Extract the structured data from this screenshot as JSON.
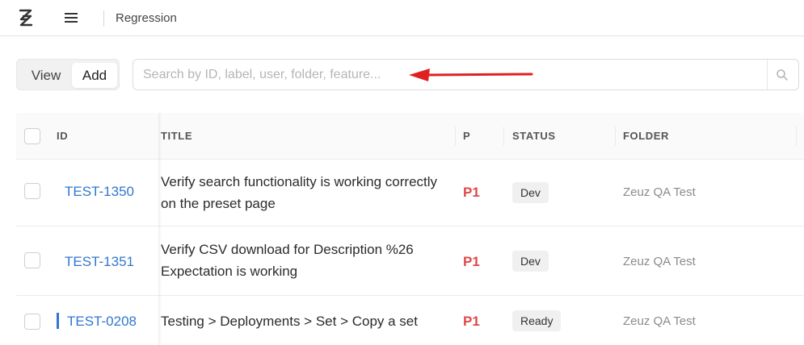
{
  "header": {
    "breadcrumb": "Regression"
  },
  "mode_toggle": {
    "view_label": "View",
    "add_label": "Add"
  },
  "search": {
    "placeholder": "Search by ID, label, user, folder, feature...",
    "value": ""
  },
  "table": {
    "columns": {
      "id": "ID",
      "title": "TITLE",
      "priority": "P",
      "status": "STATUS",
      "folder": "FOLDER"
    },
    "rows": [
      {
        "id": "TEST-1350",
        "title_line1": "Verify search functionality is working correctly",
        "title_line2": "on the preset page",
        "priority": "P1",
        "status": "Dev",
        "folder": "Zeuz QA Test"
      },
      {
        "id": "TEST-1351",
        "title_line1": "Verify CSV download for Description %26",
        "title_line2": "Expectation is working",
        "priority": "P1",
        "status": "Dev",
        "folder": "Zeuz QA Test"
      },
      {
        "id": "TEST-0208",
        "title_line1": "Testing > Deployments > Set > Copy a set",
        "title_line2": "",
        "priority": "P1",
        "status": "Ready",
        "folder": "Zeuz QA Test"
      }
    ]
  },
  "colors": {
    "link": "#2f77d0",
    "priority": "#e04848",
    "annotation_arrow": "#e02020"
  },
  "icons": {
    "logo": "app-logo-icon",
    "menu": "hamburger-menu-icon",
    "search": "search-icon",
    "annotation": "red-arrow-annotation"
  }
}
